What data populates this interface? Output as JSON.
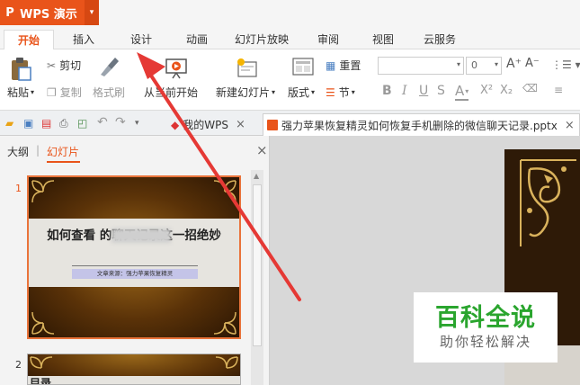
{
  "app": {
    "logo": "P",
    "name": "WPS 演示",
    "dropdown": "▾"
  },
  "menu": {
    "tabs": [
      {
        "label": "开始",
        "active": true
      },
      {
        "label": "插入"
      },
      {
        "label": "设计"
      },
      {
        "label": "动画"
      },
      {
        "label": "幻灯片放映"
      },
      {
        "label": "审阅"
      },
      {
        "label": "视图"
      },
      {
        "label": "云服务"
      }
    ]
  },
  "ribbon": {
    "paste": "粘贴",
    "cut": "剪切",
    "copy": "复制",
    "format_painter": "格式刷",
    "from_current": "从当前开始",
    "new_slide": "新建幻灯片",
    "layout": "版式",
    "reset": "重置",
    "section": "节",
    "font_size": "0",
    "bold": "B",
    "italic": "I",
    "underline": "U",
    "shadow": "S",
    "font_color": "A",
    "superscript": "X²",
    "subscript": "X₂",
    "grow_font": "A⁺",
    "shrink_font": "A⁻"
  },
  "docbar": {
    "tabs": [
      {
        "label": "我的WPS"
      },
      {
        "label": "强力苹果恢复精灵如何恢复手机删除的微信聊天记录.pptx"
      }
    ],
    "close": "×"
  },
  "panel": {
    "outline": "大纲",
    "separator": "|",
    "slides": "幻灯片",
    "close": "×",
    "slide1_num": "1",
    "slide2_num": "2",
    "slide1_title": "如何查看            的聊天记录这一招绝妙",
    "slide1_subtitle": "文章来源：强力苹果恢复精灵",
    "slide2_title": "目录"
  },
  "watermark": {
    "title": "百科全说",
    "subtitle": "助你轻松解决"
  },
  "colors": {
    "accent": "#e9541a",
    "arrow": "#e53935",
    "watermark": "#2aa52e"
  }
}
